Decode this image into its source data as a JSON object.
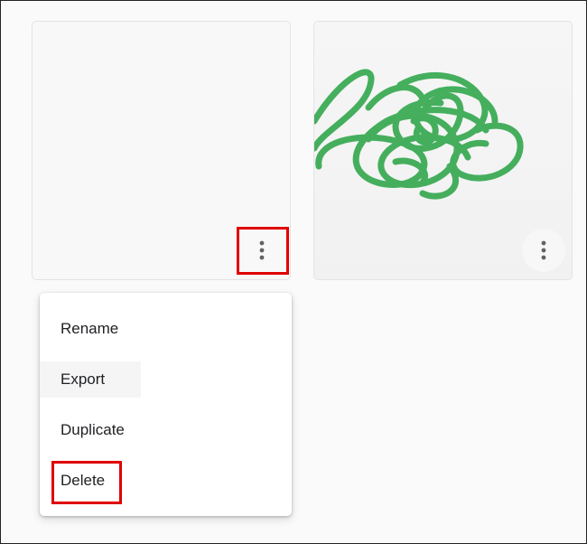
{
  "cards": [
    {
      "id": "blank-canvas"
    },
    {
      "id": "scribble-canvas",
      "drawing_color": "#3cab55"
    }
  ],
  "more_icon": "more-vert-icon",
  "context_menu": {
    "items": [
      {
        "label": "Rename"
      },
      {
        "label": "Export"
      },
      {
        "label": "Duplicate"
      },
      {
        "label": "Delete"
      }
    ]
  },
  "colors": {
    "highlight": "#e00000",
    "icon": "#5f6368",
    "text": "#202124"
  }
}
